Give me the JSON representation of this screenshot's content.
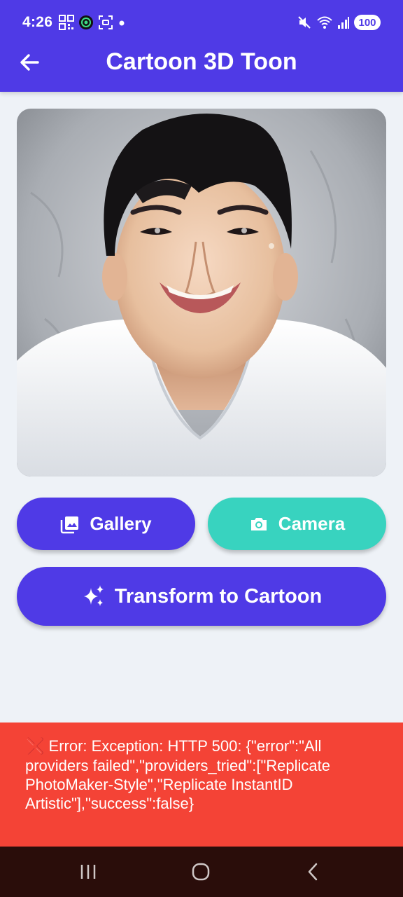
{
  "status_bar": {
    "time": "4:26",
    "battery": "100",
    "left_icons": [
      "qr-code-icon",
      "camera-app-icon",
      "screenshot-icon",
      "dot-icon"
    ],
    "right_icons": [
      "mute-icon",
      "wifi-icon",
      "signal-icon"
    ]
  },
  "header": {
    "title": "Cartoon 3D Toon",
    "back_icon": "arrow-left-icon",
    "color": "#4f3ae6"
  },
  "photo": {
    "description_icon": "selected-photo"
  },
  "buttons": {
    "gallery_label": "Gallery",
    "gallery_icon": "image-icon",
    "camera_label": "Camera",
    "camera_icon": "camera-icon",
    "transform_label": "Transform to Cartoon",
    "transform_icon": "sparkles-icon",
    "primary_color": "#4f3ae6",
    "secondary_color": "#38d3bf"
  },
  "error": {
    "icon": "❌",
    "message": " Error: Exception: HTTP 500: {\"error\":\"All providers failed\",\"providers_tried\":[\"Replicate PhotoMaker-Style\",\"Replicate InstantID Artistic\"],\"success\":false}",
    "color": "#f44336"
  },
  "nav": {
    "items": [
      "recent-apps-icon",
      "home-icon",
      "back-icon"
    ]
  }
}
